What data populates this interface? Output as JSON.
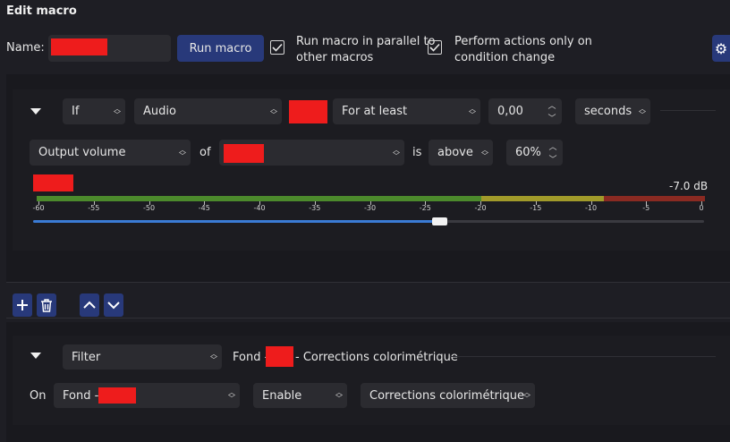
{
  "window": {
    "title": "Edit macro"
  },
  "header": {
    "name_label": "Name:",
    "run_macro": "Run macro",
    "parallel_line1": "Run macro in parallel to",
    "parallel_line2": "other macros",
    "condition_line1": "Perform actions only on",
    "condition_line2": "condition change",
    "parallel_checked": true,
    "condition_checked": true
  },
  "condition": {
    "logic": "If",
    "type": "Audio",
    "duration_mode": "For at least",
    "duration_value": "0,00",
    "duration_unit": "seconds",
    "measure": "Output volume",
    "of_label": "of",
    "is_label": "is",
    "comparison": "above",
    "threshold": "60%",
    "level_readout": "-7.0 dB",
    "level_fraction": 0.605,
    "meter_ticks": [
      "-60",
      "-55",
      "-50",
      "-45",
      "-40",
      "-35",
      "-30",
      "-25",
      "-20",
      "-15",
      "-10",
      "-5",
      "0"
    ]
  },
  "toolbar": {
    "add": "add-icon",
    "delete": "trash-icon",
    "up": "chevron-up-icon",
    "down": "chevron-down-icon"
  },
  "action": {
    "type": "Filter",
    "summary_prefix": "Fond -",
    "summary_suffix": "- Corrections colorimétrique",
    "on_label": "On",
    "source_prefix": "Fond -",
    "action_type": "Enable",
    "filter_name": "Corrections colorimétrique"
  },
  "colors": {
    "accent": "#28397a",
    "redacted": "#ee1c1c",
    "meter_green": "#4c8a2c",
    "meter_yellow": "#a19a2a",
    "meter_red": "#8a2a22",
    "slider": "#3a7bd5"
  }
}
